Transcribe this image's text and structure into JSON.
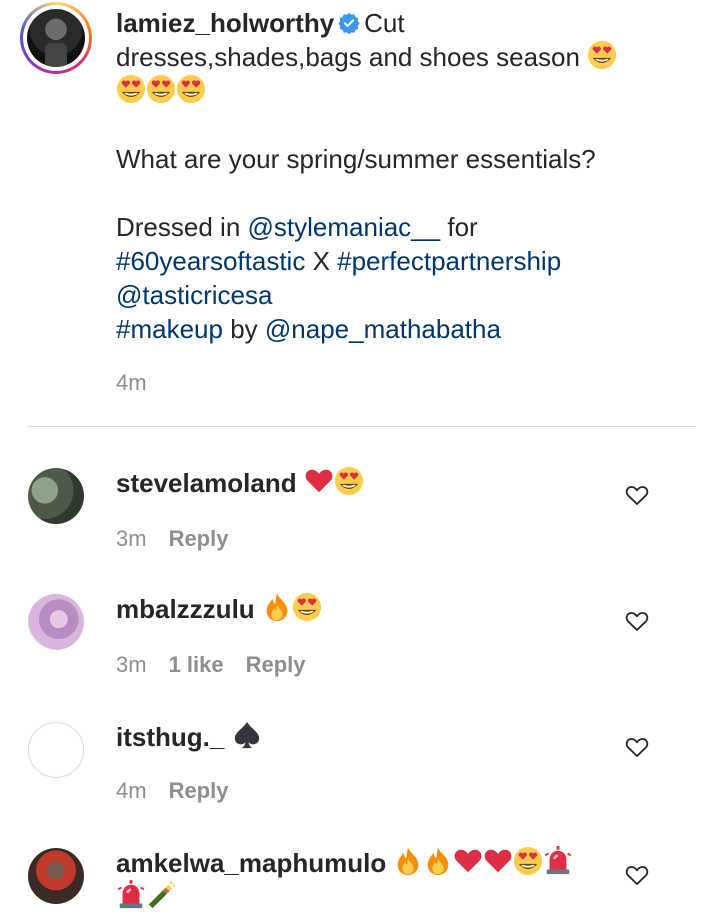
{
  "caption": {
    "username": "lamiez_holworthy",
    "verified": true,
    "line1_rest": "Cut",
    "line2": "dresses,shades,bags and shoes season",
    "question": "What are your spring/summer essentials?",
    "dressed_in": "Dressed in",
    "mention_stylist": "@stylemaniac__",
    "for_word": "for",
    "hashtag1": "#60yearsoftastic",
    "x_word": "X",
    "hashtag2": "#perfectpartnership",
    "mention_brand": "@tasticricesa",
    "hashtag_makeup": "#makeup",
    "by_word": "by",
    "mention_makeup": "@nape_mathabatha",
    "time": "4m"
  },
  "comments": [
    {
      "username": "stevelamoland",
      "time": "3m",
      "likes": "",
      "reply": "Reply",
      "emojis": [
        "heart",
        "heart-eyes"
      ]
    },
    {
      "username": "mbalzzzulu",
      "time": "3m",
      "likes": "1 like",
      "reply": "Reply",
      "emojis": [
        "fire",
        "heart-eyes"
      ]
    },
    {
      "username": "itsthug._",
      "time": "4m",
      "likes": "",
      "reply": "Reply",
      "emojis": [
        "spade"
      ]
    },
    {
      "username": "amkelwa_maphumulo",
      "time": "",
      "likes": "",
      "reply": "",
      "emojis": [
        "fire",
        "fire",
        "heart",
        "heart",
        "heart-eyes",
        "siren",
        "siren",
        "champagne"
      ]
    }
  ],
  "colors": {
    "text": "#262626",
    "link": "#00376b",
    "muted": "#8e8e8e",
    "verified": "#3897f0",
    "divider": "#dbdbdb"
  },
  "icons": {
    "like": "heart-outline-icon",
    "verified": "verified-badge-icon"
  }
}
